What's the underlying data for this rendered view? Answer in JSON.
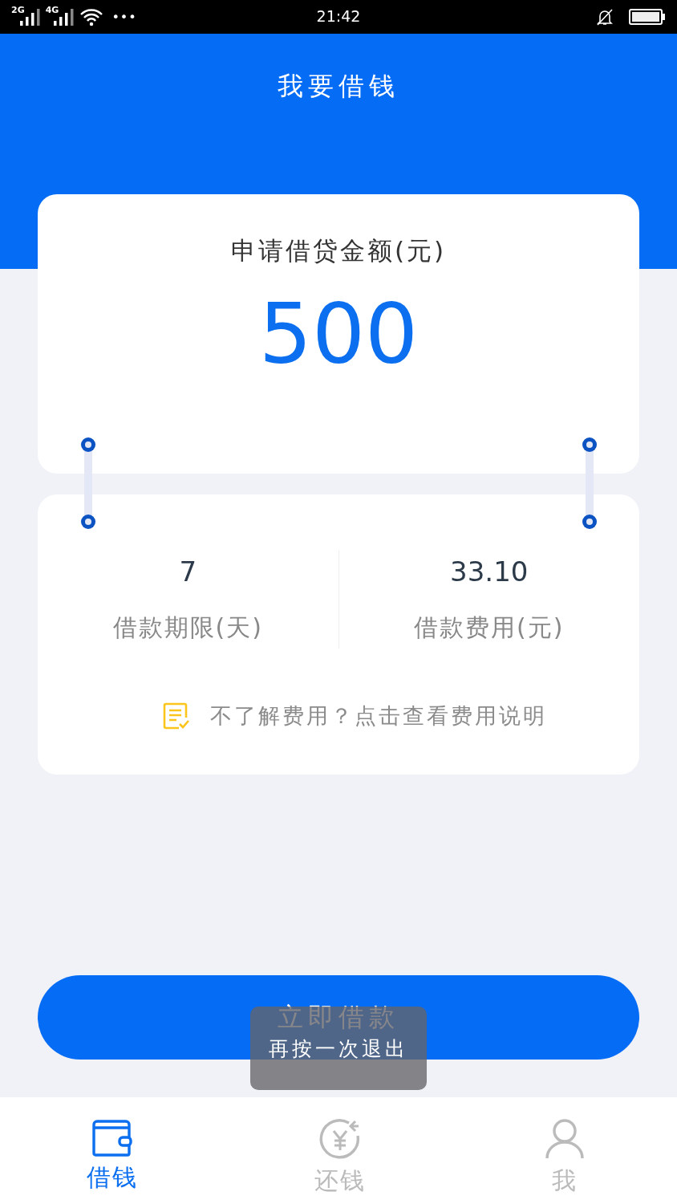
{
  "status_bar": {
    "networks": [
      "2G",
      "4G"
    ],
    "more": "•••",
    "time": "21:42"
  },
  "header": {
    "title": "我要借钱"
  },
  "amount_card": {
    "label": "申请借贷金额(元)",
    "amount": "500"
  },
  "info_card": {
    "stats": [
      {
        "value": "7",
        "label": "借款期限(天)"
      },
      {
        "value": "33.10",
        "label": "借款费用(元)"
      }
    ],
    "fee_link": "不了解费用？点击查看费用说明"
  },
  "loan_button": {
    "label": "立即借款"
  },
  "toast": {
    "text": "再按一次退出"
  },
  "tab_bar": {
    "items": [
      {
        "label": "借钱",
        "kind": "wallet",
        "selected": true
      },
      {
        "label": "还钱",
        "kind": "repay",
        "selected": false
      },
      {
        "label": "我",
        "kind": "person",
        "selected": false
      }
    ]
  }
}
